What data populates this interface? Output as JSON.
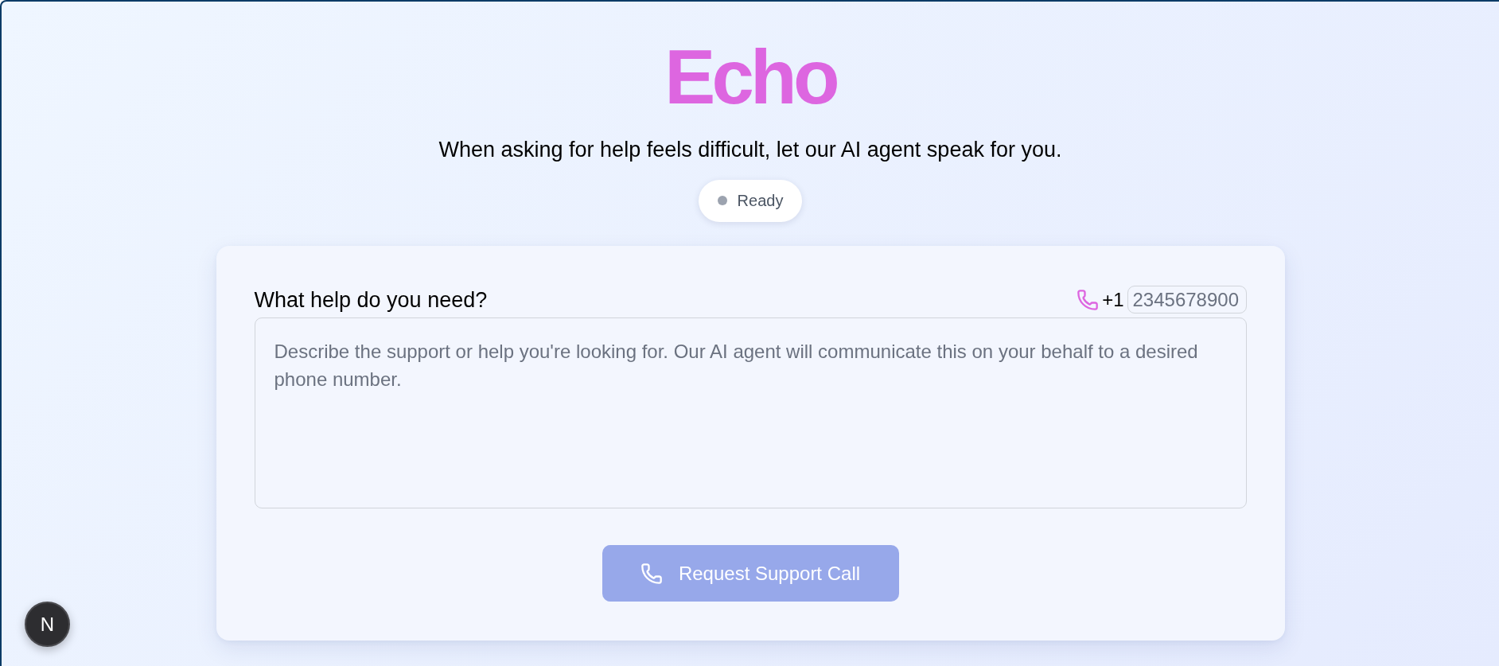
{
  "app": {
    "title": "Echo",
    "tagline": "When asking for help feels difficult, let our AI agent speak for you."
  },
  "status": {
    "label": "Ready",
    "active": false
  },
  "request_form": {
    "label": "What help do you need?",
    "country_code": "+1",
    "phone_field": {
      "placeholder": "2345678900"
    },
    "message_field": {
      "placeholder": "Describe the support or help you're looking for. Our AI agent will communicate this on your behalf to a desired phone number."
    },
    "submit_button": {
      "label": "Request Support Call",
      "disabled": true
    }
  },
  "dev_indicator": {
    "label": "N"
  }
}
